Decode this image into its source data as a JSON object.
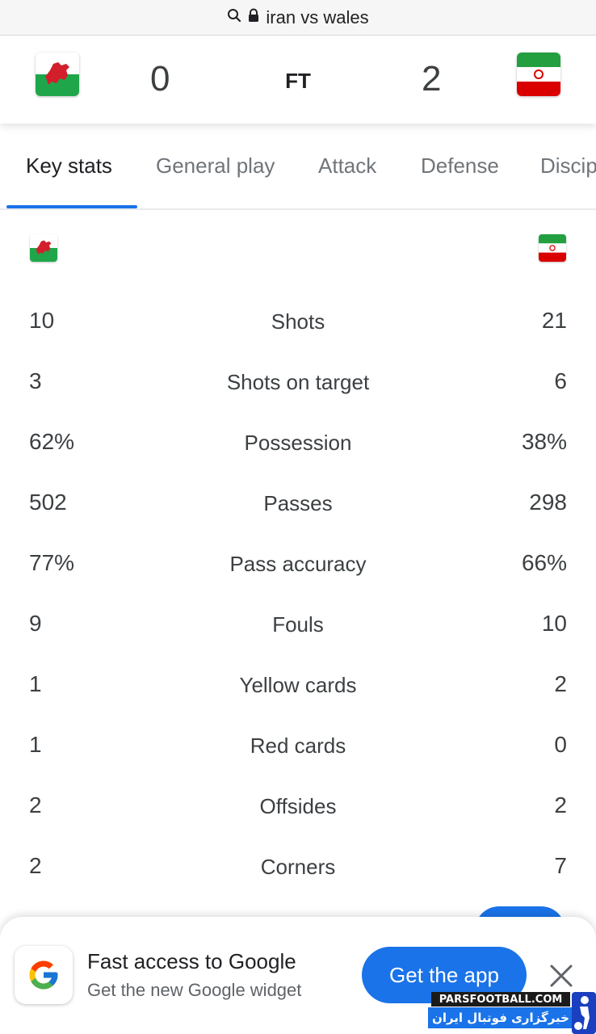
{
  "browser": {
    "url_text": "iran vs wales",
    "icons": [
      "search-icon",
      "lock-icon"
    ]
  },
  "match": {
    "home_flag": "wales-flag-icon",
    "home_score": "0",
    "status": "FT",
    "away_score": "2",
    "away_flag": "iran-flag-icon"
  },
  "tabs": [
    {
      "label": "Key stats",
      "active": true
    },
    {
      "label": "General play",
      "active": false
    },
    {
      "label": "Attack",
      "active": false
    },
    {
      "label": "Defense",
      "active": false
    },
    {
      "label": "Discip",
      "active": false
    }
  ],
  "stats": [
    {
      "label": "Shots",
      "home": "10",
      "away": "21"
    },
    {
      "label": "Shots on target",
      "home": "3",
      "away": "6"
    },
    {
      "label": "Possession",
      "home": "62%",
      "away": "38%"
    },
    {
      "label": "Passes",
      "home": "502",
      "away": "298"
    },
    {
      "label": "Pass accuracy",
      "home": "77%",
      "away": "66%"
    },
    {
      "label": "Fouls",
      "home": "9",
      "away": "10"
    },
    {
      "label": "Yellow cards",
      "home": "1",
      "away": "2"
    },
    {
      "label": "Red cards",
      "home": "1",
      "away": "0"
    },
    {
      "label": "Offsides",
      "home": "2",
      "away": "2"
    },
    {
      "label": "Corners",
      "home": "2",
      "away": "7"
    }
  ],
  "promo": {
    "title": "Fast access to Google",
    "subtitle": "Get the new Google widget",
    "button_label": "Get the app",
    "icon": "google-g-icon",
    "close_icon": "close-icon"
  },
  "watermark": {
    "site": "PARSFOOTBALL.COM",
    "tagline": "خبرگزاری فوتبال ایران"
  },
  "colors": {
    "accent": "#1a73e8",
    "text": "#202124",
    "muted": "#70757a"
  }
}
